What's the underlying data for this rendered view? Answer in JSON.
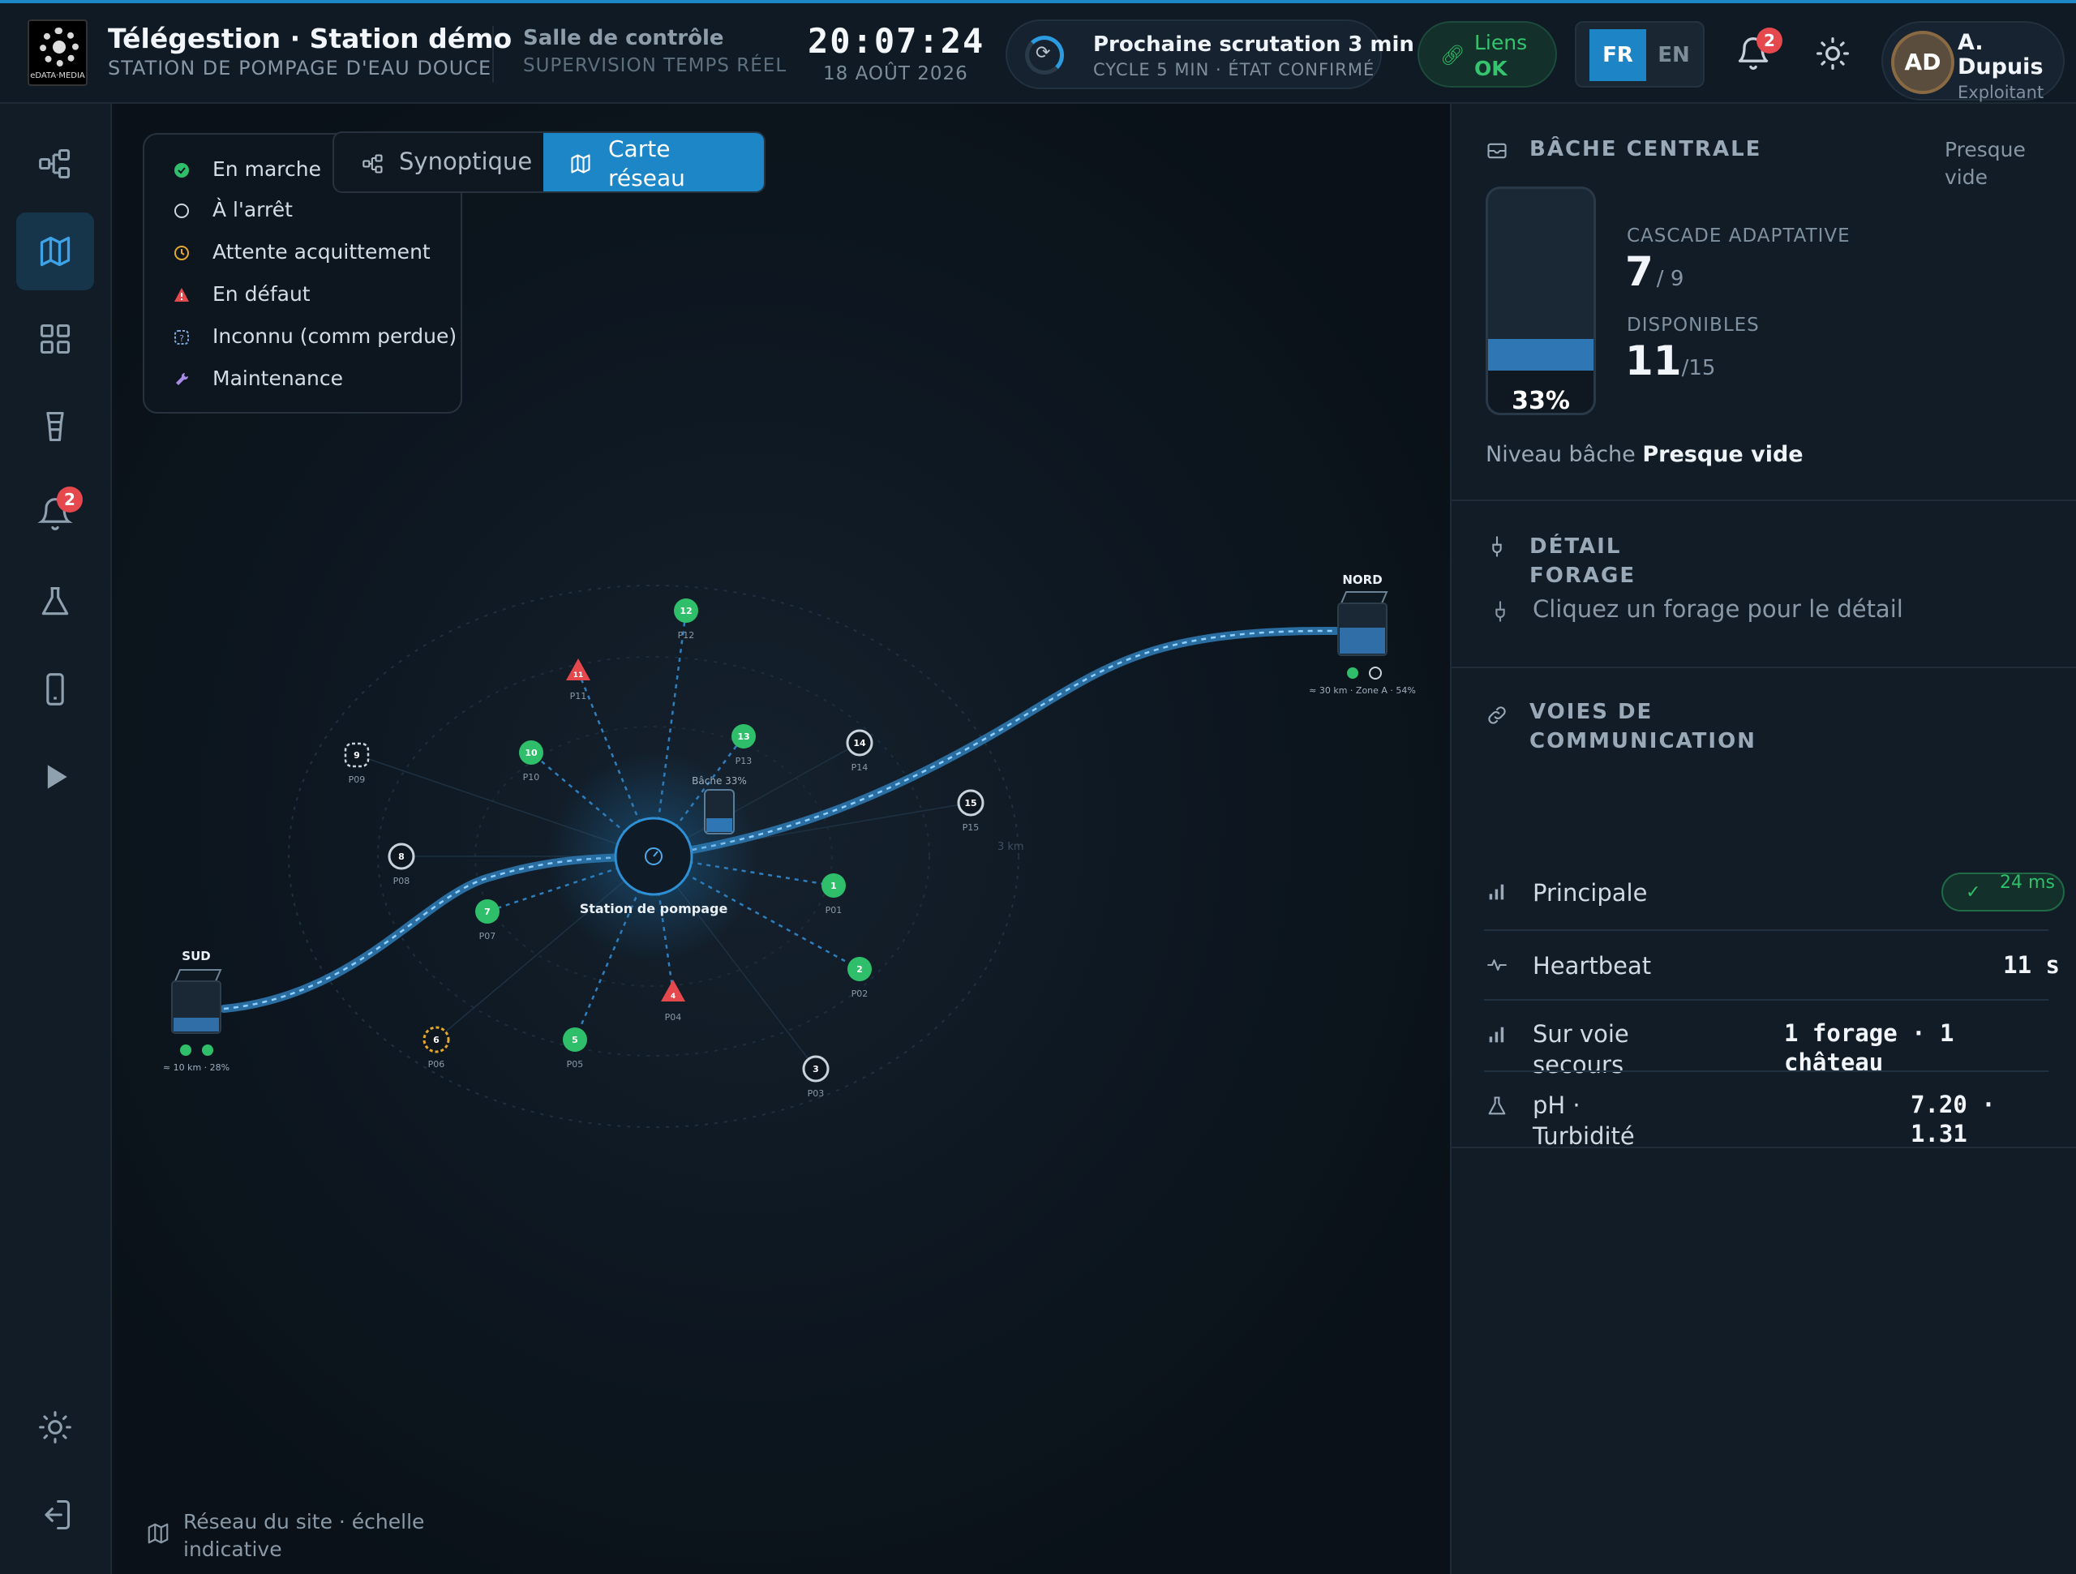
{
  "header": {
    "logo_text": "eDATA·MEDIA",
    "title": "Télégestion · Station démo",
    "subtitle": "STATION DE POMPAGE D'EAU DOUCE",
    "control_title": "Salle de contrôle",
    "control_sub": "SUPERVISION TEMPS RÉEL",
    "clock": "20:07:24",
    "date": "18 AOÛT 2026",
    "scan_title": "Prochaine scrutation 3 min",
    "scan_sub": "CYCLE 5 MIN · ÉTAT CONFIRMÉ",
    "scan_progress": 0.4,
    "links_line1": "Liens",
    "links_line2": "OK",
    "lang_fr": "FR",
    "lang_en": "EN",
    "notif_count": "2",
    "user_name": "A. Dupuis",
    "user_role": "Exploitant",
    "user_initials": "AD"
  },
  "sidebar": {
    "alarm_badge": "2",
    "items": [
      "synoptic-icon",
      "map-icon",
      "grid-icon",
      "tower-icon",
      "bell-icon",
      "flask-icon",
      "phone-icon",
      "play-icon",
      "sun-icon",
      "logout-icon"
    ]
  },
  "map": {
    "legend": [
      {
        "label": "En marche",
        "icon": "check-circle-icon"
      },
      {
        "label": "À l'arrêt",
        "icon": "circle-icon"
      },
      {
        "label": "Attente acquittement",
        "icon": "clock-icon"
      },
      {
        "label": "En défaut",
        "icon": "warning-icon"
      },
      {
        "label": "Inconnu (comm perdue)",
        "icon": "question-icon"
      },
      {
        "label": "Maintenance",
        "icon": "wrench-icon"
      }
    ],
    "tab_synoptic": "Synoptique",
    "tab_map": "Carte réseau",
    "station_label": "Station de pompage",
    "bache_label": "Bâche 33%",
    "ring_label": "3 km",
    "nord": {
      "name": "NORD",
      "caption": "≈ 30 km · Zone A · 54%",
      "level": 0.54
    },
    "sud": {
      "name": "SUD",
      "caption": "≈ 10 km · 28%",
      "level": 0.28
    },
    "wells": [
      {
        "num": "1",
        "label": "P01",
        "status": "run"
      },
      {
        "num": "2",
        "label": "P02",
        "status": "run"
      },
      {
        "num": "3",
        "label": "P03",
        "status": "stop"
      },
      {
        "num": "4",
        "label": "P04",
        "status": "fault"
      },
      {
        "num": "5",
        "label": "P05",
        "status": "run"
      },
      {
        "num": "6",
        "label": "P06",
        "status": "wait"
      },
      {
        "num": "7",
        "label": "P07",
        "status": "run"
      },
      {
        "num": "8",
        "label": "P08",
        "status": "stop"
      },
      {
        "num": "9",
        "label": "P09",
        "status": "unknown"
      },
      {
        "num": "10",
        "label": "P10",
        "status": "run"
      },
      {
        "num": "11",
        "label": "P11",
        "status": "fault"
      },
      {
        "num": "12",
        "label": "P12",
        "status": "run"
      },
      {
        "num": "13",
        "label": "P13",
        "status": "run"
      },
      {
        "num": "14",
        "label": "P14",
        "status": "stop"
      },
      {
        "num": "15",
        "label": "P15",
        "status": "stop"
      }
    ],
    "footer": "Réseau du site · échelle indicative"
  },
  "panel": {
    "bache_title": "BÂCHE CENTRALE",
    "bache_state": "Presque vide",
    "bache_level_pct": "33%",
    "bache_level": 0.33,
    "cascade_label": "CASCADE ADAPTATIVE",
    "cascade_value": "7",
    "cascade_total": "/ 9",
    "dispo_label": "DISPONIBLES",
    "dispo_value": "11",
    "dispo_total": "/15",
    "niveau_prefix": "Niveau bâche",
    "niveau_value": "Presque vide",
    "forage_title": "DÉTAIL FORAGE",
    "forage_hint": "Cliquez un forage pour le détail",
    "comm_title": "VOIES DE COMMUNICATION",
    "principale_label": "Principale",
    "principale_value": "24 ms",
    "heartbeat_label": "Heartbeat",
    "heartbeat_value": "11 s",
    "secours_label": "Sur voie secours",
    "secours_value": "1 forage · 1 château",
    "ph_label": "pH · Turbidité",
    "ph_value": "7.20 · 1.31"
  },
  "colors": {
    "accent": "#1d86c6",
    "run": "#2fbf6a",
    "fault": "#e5484d",
    "wait": "#e6a82a",
    "stop": "#c9d3dc",
    "maintenance": "#a98be8"
  }
}
